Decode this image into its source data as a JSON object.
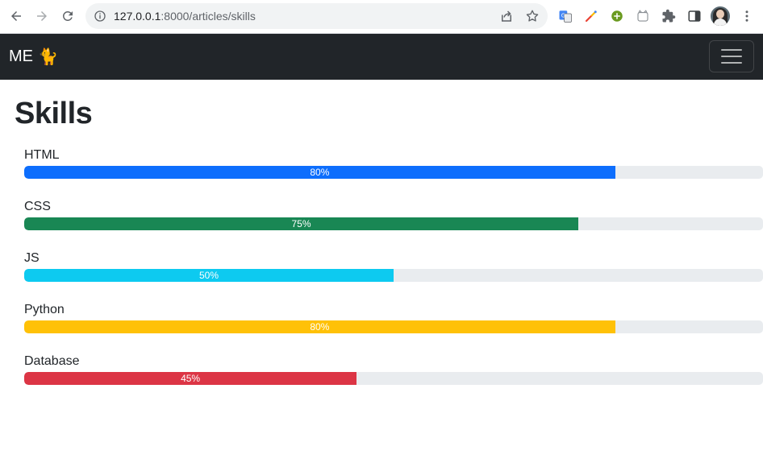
{
  "browser": {
    "url_host": "127.0.0.1",
    "url_rest": ":8000/articles/skills",
    "back_icon": "back-arrow-icon",
    "forward_icon": "forward-arrow-icon",
    "reload_icon": "reload-icon"
  },
  "navbar": {
    "brand_text": "ME",
    "brand_emoji": "🐈",
    "toggler_icon": "hamburger-icon",
    "background": "#212529"
  },
  "page": {
    "title": "Skills"
  },
  "skills": [
    {
      "label": "HTML",
      "percent": 80,
      "percent_label": "80%",
      "color": "#0d6efd"
    },
    {
      "label": "CSS",
      "percent": 75,
      "percent_label": "75%",
      "color": "#198754"
    },
    {
      "label": "JS",
      "percent": 50,
      "percent_label": "50%",
      "color": "#0dcaf0"
    },
    {
      "label": "Python",
      "percent": 80,
      "percent_label": "80%",
      "color": "#ffc107"
    },
    {
      "label": "Database",
      "percent": 45,
      "percent_label": "45%",
      "color": "#dc3545"
    }
  ]
}
